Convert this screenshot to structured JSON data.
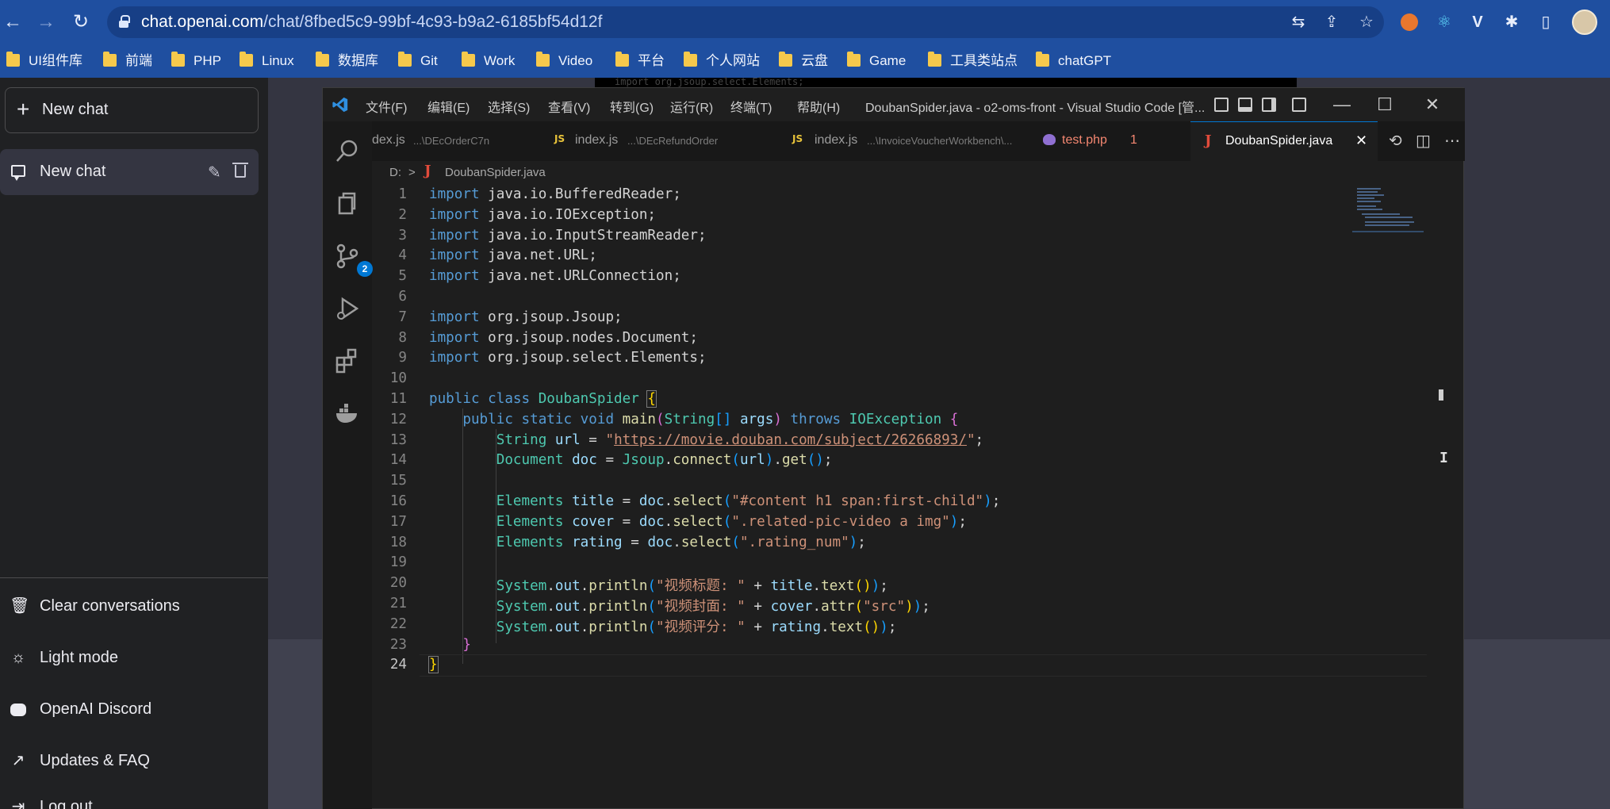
{
  "browser": {
    "url_host": "chat.openai.com",
    "url_path": "/chat/8fbed5c9-99bf-4c93-b9a2-6185bf54d12f",
    "bookmarks": [
      "UI组件库",
      "前端",
      "PHP",
      "Linux",
      "数据库",
      "Git",
      "Work",
      "Video",
      "平台",
      "个人网站",
      "云盘",
      "Game",
      "工具类站点",
      "chatGPT"
    ]
  },
  "sidebar": {
    "new_chat_label": "New chat",
    "conversations": [
      {
        "label": "New chat"
      }
    ],
    "links": [
      {
        "label": "Clear conversations",
        "icon": "trash-icon"
      },
      {
        "label": "Light mode",
        "icon": "sun-icon"
      },
      {
        "label": "OpenAI Discord",
        "icon": "discord-icon"
      },
      {
        "label": "Updates & FAQ",
        "icon": "external-link-icon"
      },
      {
        "label": "Log out",
        "icon": "logout-icon"
      }
    ]
  },
  "vscode": {
    "menus": [
      "文件(F)",
      "编辑(E)",
      "选择(S)",
      "查看(V)",
      "转到(G)",
      "运行(R)",
      "终端(T)",
      "帮助(H)"
    ],
    "title": "DoubanSpider.java - o2-oms-front - Visual Studio Code [管...",
    "strip_text": "import org.jsoup.select.Elements;",
    "scm_badge": "2",
    "tabs": [
      {
        "name": "dex.js",
        "path": "...\\DEcOrderC7n",
        "type": "js"
      },
      {
        "name": "index.js",
        "path": "...\\DEcRefundOrder",
        "type": "js"
      },
      {
        "name": "index.js",
        "path": "...\\InvoiceVoucherWorkbench\\...",
        "type": "js"
      },
      {
        "name": "test.php",
        "badge": "1",
        "type": "php"
      },
      {
        "name": "DoubanSpider.java",
        "type": "java",
        "active": true
      }
    ],
    "breadcrumb": {
      "drive": "D:",
      "file": "DoubanSpider.java"
    },
    "line_numbers": [
      "1",
      "2",
      "3",
      "4",
      "5",
      "6",
      "7",
      "8",
      "9",
      "10",
      "11",
      "12",
      "13",
      "14",
      "15",
      "16",
      "17",
      "18",
      "19",
      "20",
      "21",
      "22",
      "23",
      "24"
    ],
    "code": {
      "l1_pkg": "java.io.BufferedReader",
      "l2_pkg": "java.io.IOException",
      "l3_pkg": "java.io.InputStreamReader",
      "l4_pkg": "java.net.URL",
      "l5_pkg": "java.net.URLConnection",
      "l7_pkg": "org.jsoup.Jsoup",
      "l8_pkg": "org.jsoup.nodes.Document",
      "l9_pkg": "org.jsoup.select.Elements",
      "class_name": "DoubanSpider",
      "url_value": "https://movie.douban.com/subject/26266893/",
      "sel_title": "\"#content h1 span:first-child\"",
      "sel_cover": "\".related-pic-video a img\"",
      "sel_rating": "\".rating_num\"",
      "msg_title": "\"视频标题: \"",
      "msg_cover": "\"视频封面: \"",
      "msg_rating": "\"视频评分: \"",
      "attr_src": "\"src\""
    }
  }
}
